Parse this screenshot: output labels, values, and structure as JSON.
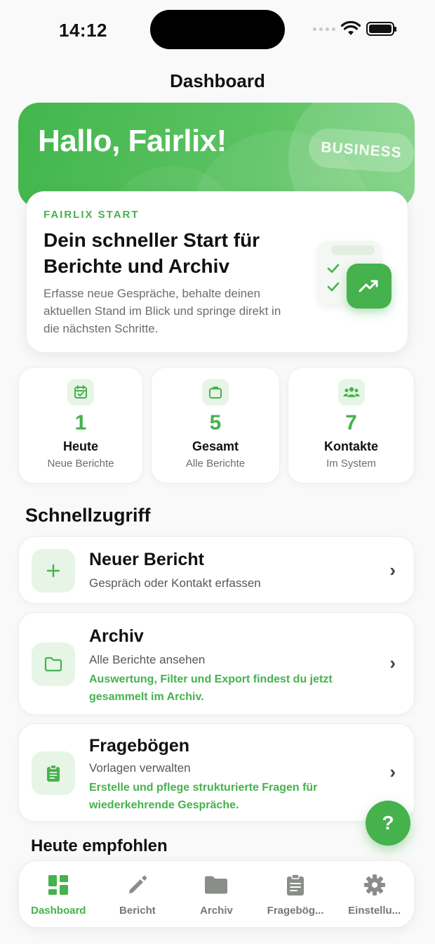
{
  "colors": {
    "accent": "#45b24d",
    "accent_soft": "#e6f5e6",
    "muted_icon": "#8a8d8a"
  },
  "status_bar": {
    "time": "14:12"
  },
  "nav": {
    "title": "Dashboard"
  },
  "hero": {
    "greeting": "Hallo, Fairlix!",
    "badge": "BUSINESS"
  },
  "start_card": {
    "eyebrow": "FAIRLIX START",
    "title": "Dein schneller Start für Berichte und Archiv",
    "description": "Erfasse neue Gespräche, behalte deinen aktuellen Stand im Blick und springe direkt in die nächsten Schritte."
  },
  "stats": [
    {
      "icon": "calendar-check-icon",
      "value": "1",
      "label": "Heute",
      "sub": "Neue Berichte"
    },
    {
      "icon": "briefcase-icon",
      "value": "5",
      "label": "Gesamt",
      "sub": "Alle Berichte"
    },
    {
      "icon": "people-icon",
      "value": "7",
      "label": "Kontakte",
      "sub": "Im System"
    }
  ],
  "quick_access": {
    "title": "Schnellzugriff",
    "items": [
      {
        "icon": "plus-icon",
        "title": "Neuer Bericht",
        "subtitle": "Gespräch oder Kontakt erfassen",
        "hint": ""
      },
      {
        "icon": "folder-icon",
        "title": "Archiv",
        "subtitle": "Alle Berichte ansehen",
        "hint": "Auswertung, Filter und Export findest du jetzt gesammelt im Archiv."
      },
      {
        "icon": "clipboard-icon",
        "title": "Fragebögen",
        "subtitle": "Vorlagen verwalten",
        "hint": "Erstelle und pflege strukturierte Fragen für wiederkehrende Gespräche."
      }
    ]
  },
  "recommended": {
    "title": "Heute empfohlen"
  },
  "help": {
    "label": "?"
  },
  "tabbar": {
    "active": "Dashboard",
    "tabs": [
      {
        "icon": "dashboard-icon",
        "label": "Dashboard"
      },
      {
        "icon": "pencil-icon",
        "label": "Bericht"
      },
      {
        "icon": "folder-icon",
        "label": "Archiv"
      },
      {
        "icon": "clipboard-icon",
        "label": "Fragebög..."
      },
      {
        "icon": "gear-icon",
        "label": "Einstellu..."
      }
    ]
  }
}
